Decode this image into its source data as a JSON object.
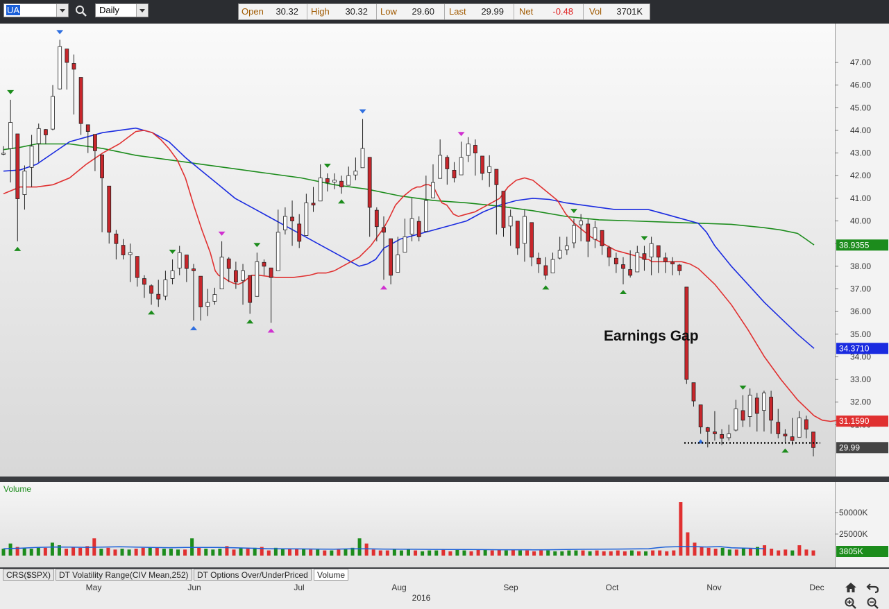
{
  "toolbar": {
    "symbol": "UA",
    "interval": "Daily",
    "quote": {
      "open_label": "Open",
      "open": "30.32",
      "high_label": "High",
      "high": "30.32",
      "low_label": "Low",
      "low": "29.60",
      "last_label": "Last",
      "last": "29.99",
      "net_label": "Net",
      "net": "-0.48",
      "vol_label": "Vol",
      "vol": "3701K"
    }
  },
  "colors": {
    "bull_candle": "#ffffff",
    "bear_candle": "#c8262b",
    "ma_short": "#e03030",
    "ma_mid": "#1a2be0",
    "ma_long": "#1c8c1c",
    "volume_up": "#1c8c1c",
    "volume_down": "#e03030",
    "volume_avg": "#1a5fd8"
  },
  "chart_data": [
    {
      "type": "candlestick",
      "symbol": "UA",
      "xlabel": "2016",
      "month_ticks": [
        "May",
        "Jun",
        "Jul",
        "Aug",
        "Sep",
        "Oct",
        "Nov",
        "Dec"
      ],
      "y_ticks": [
        34.0,
        35.0,
        36.0,
        37.0,
        38.0,
        39.0,
        40.0,
        41.0,
        42.0,
        43.0,
        44.0,
        45.0,
        46.0,
        47.0
      ],
      "y_tick_labels": [
        "34.00",
        "35.00",
        "36.00",
        "37.00",
        "38.00",
        "39.00",
        "40.00",
        "41.00",
        "42.00",
        "43.00",
        "44.00",
        "45.00",
        "46.00",
        "47.00",
        "33.00",
        "32.00",
        "31.00"
      ],
      "ylim": [
        29.0,
        48.7
      ],
      "annotation": "Earnings Gap",
      "support_level": 30.2,
      "price_labels": {
        "ma_long": "38.9355",
        "ma_mid": "34.3710",
        "ma_short": "31.1590",
        "last": "29.99"
      },
      "close": [
        42.99,
        44.35,
        40.98,
        42.2,
        43.3,
        44.08,
        43.8,
        45.5,
        47.7,
        47.0,
        46.7,
        44.3,
        43.95,
        43.1,
        41.9,
        39.5,
        39.0,
        38.5,
        38.6,
        37.5,
        37.2,
        36.8,
        36.55,
        37.4,
        37.8,
        38.6,
        37.9,
        37.8,
        36.2,
        36.4,
        36.75,
        38.4,
        37.9,
        37.3,
        37.8,
        36.4,
        38.2,
        38.0,
        37.5,
        39.5,
        40.2,
        40.0,
        39.1,
        40.8,
        40.7,
        41.9,
        41.7,
        41.8,
        41.5,
        42.0,
        42.2,
        43.2,
        40.6,
        39.75,
        39.5,
        37.6,
        38.5,
        39.3,
        40.1,
        39.3,
        40.9,
        41.7,
        42.9,
        42.3,
        41.9,
        42.8,
        43.4,
        43.0,
        42.1,
        42.4,
        41.6,
        39.7,
        40.2,
        38.8,
        40.2,
        38.4,
        38.1,
        37.6,
        38.3,
        38.7,
        38.9,
        39.8,
        40.0,
        39.1,
        39.7,
        38.9,
        38.4,
        38.1,
        37.9,
        37.6,
        38.6,
        38.3,
        39.0,
        38.4,
        38.2,
        38.1,
        37.8,
        33.0,
        32.05,
        30.9,
        30.7,
        30.6,
        30.4,
        30.6,
        31.7,
        31.2,
        32.3,
        31.5,
        32.4,
        31.2,
        30.6,
        30.5,
        30.3,
        31.3,
        30.8,
        29.99
      ],
      "high": [
        43.3,
        45.35,
        41.2,
        42.45,
        43.8,
        44.3,
        44.06,
        46.0,
        48.0,
        47.2,
        47.35,
        45.2,
        44.2,
        43.8,
        42.1,
        40.2,
        39.6,
        39.2,
        39.0,
        38.3,
        37.6,
        37.2,
        37.4,
        37.8,
        38.3,
        38.9,
        38.2,
        38.1,
        36.6,
        37.0,
        37.05,
        39.1,
        38.4,
        38.2,
        38.1,
        37.0,
        38.6,
        38.3,
        37.9,
        40.5,
        40.6,
        40.9,
        40.3,
        41.2,
        41.5,
        42.5,
        42.1,
        42.1,
        42.0,
        42.4,
        42.8,
        44.5,
        41.4,
        40.6,
        40.2,
        38.8,
        39.3,
        40.1,
        41.0,
        40.2,
        42.0,
        42.5,
        43.6,
        42.9,
        42.6,
        43.5,
        43.7,
        43.6,
        42.7,
        42.9,
        42.0,
        40.5,
        40.5,
        40.0,
        40.5,
        39.6,
        38.6,
        38.4,
        38.6,
        39.3,
        39.3,
        40.1,
        40.3,
        40.1,
        40.0,
        39.5,
        38.9,
        38.6,
        38.4,
        38.7,
        38.9,
        38.9,
        39.3,
        38.8,
        38.6,
        38.4,
        38.1,
        33.7,
        32.7,
        31.8,
        30.9,
        31.6,
        30.8,
        31.0,
        32.1,
        32.3,
        32.6,
        32.4,
        32.5,
        32.5,
        31.7,
        30.8,
        31.3,
        31.6,
        31.4,
        30.32
      ],
      "low": [
        42.9,
        41.7,
        39.1,
        40.5,
        41.5,
        42.6,
        43.4,
        44.0,
        45.8,
        45.8,
        44.7,
        43.8,
        43.0,
        42.2,
        39.5,
        39.0,
        38.3,
        38.3,
        37.3,
        37.1,
        36.6,
        36.3,
        36.2,
        36.5,
        37.2,
        37.6,
        37.3,
        35.6,
        35.6,
        35.8,
        36.3,
        37.1,
        37.3,
        37.0,
        36.3,
        35.9,
        36.8,
        37.6,
        35.5,
        37.8,
        39.4,
        38.9,
        38.8,
        39.5,
        40.4,
        41.3,
        41.3,
        41.4,
        41.2,
        41.6,
        41.8,
        42.5,
        39.3,
        39.1,
        37.4,
        37.2,
        38.0,
        38.7,
        39.1,
        39.1,
        40.0,
        41.3,
        41.9,
        41.6,
        41.7,
        42.2,
        42.6,
        42.0,
        41.8,
        41.5,
        39.4,
        39.3,
        38.9,
        38.5,
        38.2,
        38.0,
        37.7,
        37.4,
        38.0,
        38.3,
        38.5,
        38.8,
        39.1,
        38.4,
        38.8,
        38.5,
        38.0,
        37.7,
        37.2,
        37.5,
        38.1,
        37.8,
        37.6,
        37.7,
        37.7,
        37.6,
        37.6,
        32.8,
        31.8,
        30.6,
        30.0,
        30.3,
        30.1,
        30.3,
        30.7,
        30.9,
        30.9,
        30.7,
        30.7,
        30.6,
        30.4,
        30.2,
        30.1,
        30.5,
        30.4,
        29.6
      ],
      "ma_short": [
        41.2,
        41.5,
        41.5,
        41.6,
        41.9,
        42.5,
        43.0,
        43.4,
        43.95,
        44.0,
        43.9,
        43.6,
        43.2,
        42.7,
        41.9,
        40.7,
        39.6,
        38.6,
        37.8,
        37.6,
        37.5,
        37.35,
        37.25,
        37.2,
        37.3,
        37.6,
        37.6,
        37.55,
        37.5,
        37.5,
        37.5,
        37.55,
        37.6,
        37.7,
        37.7,
        37.8,
        38.0,
        38.2,
        38.4,
        38.9,
        39.4,
        39.7,
        40.1,
        40.7,
        41.1,
        41.4,
        41.5,
        41.5,
        41.6,
        41.6,
        41.5,
        41.2,
        40.8,
        40.7,
        40.5,
        40.3,
        40.2,
        40.3,
        40.4,
        40.6,
        40.8,
        41.0,
        41.5,
        41.8,
        41.9,
        41.8,
        41.5,
        41.2,
        40.9,
        40.3,
        39.9,
        39.6,
        39.3,
        39.1,
        38.9,
        38.7,
        38.6,
        38.5,
        38.4,
        38.3,
        38.3,
        38.2,
        38.2,
        38.2,
        38.2,
        38.2,
        38.2,
        38.1,
        37.9,
        37.2,
        36.3,
        35.2,
        34.0,
        33.0,
        32.1,
        31.4,
        31.2,
        31.15,
        31.2,
        31.2,
        31.2,
        31.16
      ],
      "ma_short_x": [
        0,
        10,
        20,
        30,
        40,
        50,
        60,
        70,
        80,
        85,
        90,
        95,
        100,
        105,
        110,
        115,
        120,
        125,
        128,
        130,
        133,
        136,
        139,
        142,
        145,
        150,
        155,
        160,
        165,
        170,
        175,
        180,
        185,
        190,
        195,
        200,
        205,
        210,
        215,
        222,
        227,
        230,
        233,
        237,
        242,
        247,
        250,
        252,
        255,
        257,
        260,
        262,
        265,
        268,
        270,
        272,
        275,
        280,
        285,
        290,
        295,
        300,
        305,
        310,
        315,
        320,
        325,
        330,
        335,
        340,
        345,
        350,
        355,
        360,
        365,
        370,
        375,
        380,
        385,
        388,
        390,
        392,
        395,
        398,
        401,
        405,
        410,
        415,
        420,
        430,
        440,
        450,
        460,
        470,
        480,
        490,
        495,
        500,
        505,
        510,
        515,
        520
      ],
      "ma_mid": [
        42.2,
        42.25,
        42.5,
        43.0,
        43.5,
        43.7,
        43.9,
        44.0,
        44.1,
        43.9,
        43.5,
        42.8,
        42.2,
        41.6,
        41.0,
        40.6,
        40.2,
        39.8,
        39.4,
        39.0,
        38.6,
        38.2,
        38.0,
        38.1,
        38.3,
        38.8,
        39.2,
        39.4,
        39.6,
        39.8,
        40.0,
        40.4,
        40.7,
        40.9,
        41.0,
        40.95,
        40.8,
        40.7,
        40.6,
        40.5,
        40.5,
        40.5,
        40.3,
        40.1,
        39.9,
        39.5,
        38.9,
        38.0,
        37.2,
        36.4,
        35.7,
        35.0,
        34.37
      ],
      "ma_mid_x": [
        0,
        10,
        20,
        30,
        40,
        50,
        60,
        70,
        80,
        90,
        100,
        110,
        120,
        130,
        140,
        150,
        160,
        170,
        180,
        190,
        200,
        210,
        215,
        220,
        225,
        230,
        240,
        250,
        260,
        270,
        280,
        290,
        300,
        310,
        320,
        330,
        340,
        350,
        360,
        370,
        380,
        390,
        400,
        410,
        420,
        425,
        430,
        440,
        450,
        460,
        470,
        480,
        490
      ],
      "ma_long": [
        43.15,
        43.25,
        43.4,
        43.4,
        43.2,
        42.9,
        42.7,
        42.5,
        42.3,
        42.1,
        41.9,
        41.6,
        41.4,
        41.1,
        40.9,
        40.8,
        40.65,
        40.45,
        40.2,
        40.05,
        40.0,
        39.95,
        39.9,
        39.85,
        39.7,
        39.6,
        39.45,
        39.2,
        38.94
      ],
      "ma_long_x": [
        0,
        10,
        20,
        40,
        60,
        80,
        100,
        120,
        140,
        160,
        180,
        200,
        220,
        240,
        260,
        280,
        300,
        320,
        340,
        360,
        380,
        400,
        420,
        440,
        460,
        470,
        480,
        485,
        490
      ],
      "pivot_marks": [
        {
          "i": 1,
          "type": "high",
          "color": "green"
        },
        {
          "i": 2,
          "type": "low",
          "color": "green"
        },
        {
          "i": 8,
          "type": "high",
          "color": "blue"
        },
        {
          "i": 21,
          "type": "low",
          "color": "green"
        },
        {
          "i": 24,
          "type": "high",
          "color": "green"
        },
        {
          "i": 27,
          "type": "low",
          "color": "blue"
        },
        {
          "i": 31,
          "type": "high",
          "color": "magenta"
        },
        {
          "i": 35,
          "type": "low",
          "color": "green"
        },
        {
          "i": 36,
          "type": "high",
          "color": "green"
        },
        {
          "i": 38,
          "type": "low",
          "color": "magenta"
        },
        {
          "i": 46,
          "type": "high",
          "color": "green"
        },
        {
          "i": 48,
          "type": "low",
          "color": "green"
        },
        {
          "i": 51,
          "type": "high",
          "color": "blue"
        },
        {
          "i": 54,
          "type": "low",
          "color": "magenta"
        },
        {
          "i": 65,
          "type": "high",
          "color": "magenta"
        },
        {
          "i": 77,
          "type": "low",
          "color": "green"
        },
        {
          "i": 81,
          "type": "high",
          "color": "green"
        },
        {
          "i": 88,
          "type": "low",
          "color": "green"
        },
        {
          "i": 91,
          "type": "high",
          "color": "green"
        },
        {
          "i": 99,
          "type": "low",
          "color": "blue"
        },
        {
          "i": 105,
          "type": "high",
          "color": "green"
        },
        {
          "i": 111,
          "type": "low",
          "color": "green"
        }
      ]
    },
    {
      "type": "bar",
      "title": "Volume",
      "tick_labels": [
        "50000K",
        "25000K"
      ],
      "last_label": "3805K",
      "volume_k": [
        8000,
        14000,
        10000,
        9000,
        8000,
        10000,
        9000,
        15000,
        12000,
        8000,
        10000,
        9000,
        11000,
        20000,
        8000,
        9000,
        7000,
        8000,
        7000,
        8000,
        9000,
        10000,
        9000,
        8000,
        8000,
        7000,
        7000,
        20000,
        9000,
        8000,
        7000,
        8000,
        11000,
        7000,
        9000,
        8000,
        9000,
        10000,
        6000,
        9000,
        8000,
        8000,
        8000,
        8000,
        7000,
        7000,
        6000,
        6000,
        7000,
        8000,
        9000,
        20000,
        14000,
        7000,
        6000,
        6000,
        7000,
        6000,
        7000,
        6000,
        5000,
        6000,
        6000,
        7000,
        5000,
        7000,
        6000,
        5000,
        7000,
        7000,
        6000,
        7000,
        6000,
        7000,
        6000,
        6000,
        5000,
        6000,
        6000,
        5000,
        5000,
        6000,
        6000,
        6000,
        5000,
        6000,
        5000,
        5000,
        6000,
        5000,
        6000,
        5000,
        5000,
        6000,
        6000,
        5000,
        6000,
        62000,
        27000,
        15000,
        10000,
        9000,
        8000,
        9000,
        7000,
        7000,
        9000,
        8000,
        10000,
        12000,
        8000,
        6000,
        7000,
        6000,
        12000,
        7000,
        6000
      ],
      "volume_up": [
        true,
        true,
        false,
        true,
        true,
        true,
        false,
        true,
        true,
        false,
        false,
        false,
        false,
        false,
        true,
        false,
        false,
        true,
        true,
        false,
        false,
        true,
        false,
        true,
        true,
        true,
        false,
        true,
        false,
        true,
        true,
        true,
        false,
        false,
        true,
        false,
        true,
        false,
        false,
        true,
        true,
        false,
        false,
        true,
        false,
        true,
        false,
        true,
        false,
        true,
        true,
        true,
        false,
        false,
        false,
        false,
        true,
        true,
        true,
        false,
        true,
        true,
        true,
        false,
        false,
        true,
        true,
        false,
        false,
        true,
        false,
        false,
        true,
        false,
        true,
        false,
        false,
        false,
        true,
        true,
        true,
        true,
        true,
        false,
        true,
        false,
        false,
        false,
        false,
        false,
        true,
        false,
        true,
        false,
        false,
        false,
        false,
        false,
        false,
        false,
        false,
        false,
        false,
        true,
        true,
        false,
        true,
        false,
        true,
        false,
        false,
        false,
        false,
        true,
        false,
        false
      ],
      "volume_avg_k": [
        8000,
        8500,
        9500,
        10000,
        9800,
        9600,
        9800,
        10200,
        9800,
        9400,
        9200,
        9400,
        9500,
        9400,
        9000,
        8500,
        8000,
        7800,
        7700,
        7600,
        7500,
        7800,
        7800,
        7600,
        7400,
        7300,
        7200,
        7100,
        7000,
        6900,
        6800,
        6800,
        6700,
        6800,
        7000,
        7300,
        7600,
        8000,
        9000,
        10000,
        10500,
        10300,
        10000,
        10200,
        10500,
        9000,
        8500,
        8000
      ],
      "volume_avg_x": [
        0,
        10,
        20,
        30,
        40,
        50,
        60,
        70,
        80,
        90,
        100,
        110,
        120,
        130,
        140,
        150,
        160,
        170,
        180,
        190,
        200,
        210,
        220,
        230,
        240,
        250,
        260,
        270,
        280,
        290,
        300,
        310,
        320,
        330,
        340,
        350,
        370,
        390,
        395,
        400,
        410,
        420,
        425,
        430,
        433,
        440,
        450,
        460
      ],
      "ylim": [
        0,
        68000
      ]
    }
  ],
  "x_axis": {
    "year": "2016"
  },
  "indicator_tabs": [
    "CRS($SPX)",
    "DT Volatility Range(CIV Mean,252)",
    "DT Options Over/UnderPriced",
    "Volume"
  ]
}
